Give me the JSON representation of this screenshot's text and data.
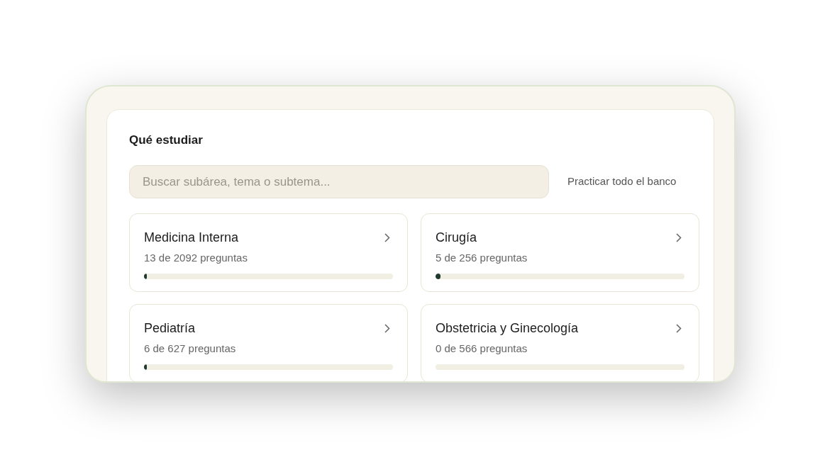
{
  "section": {
    "title": "Qué estudiar"
  },
  "search": {
    "placeholder": "Buscar subárea, tema o subtema..."
  },
  "practice_all_link": "Practicar todo el banco",
  "areas": [
    {
      "name": "Medicina Interna",
      "count": "13 de 2092 preguntas",
      "level": 0.006
    },
    {
      "name": "Cirugía",
      "count": "5 de 256 preguntas",
      "level": 0.02
    },
    {
      "name": "Pediatría",
      "count": "6 de 627 preguntas",
      "level": 0.01
    },
    {
      "name": "Obstetricia y Ginecología",
      "count": "0 de 566 preguntas",
      "level": 0
    }
  ]
}
